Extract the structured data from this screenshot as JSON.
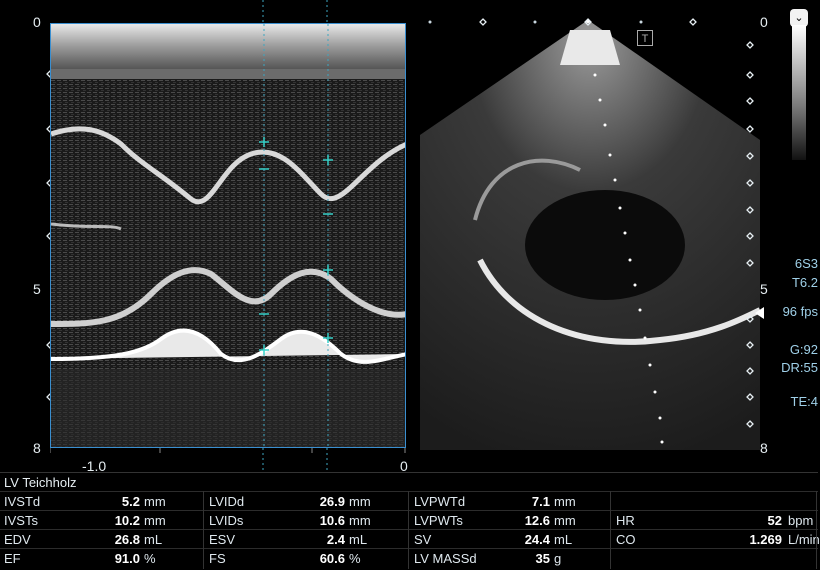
{
  "mmode": {
    "depth_ticks": [
      "0",
      "5",
      "8"
    ],
    "time_ticks": [
      "-1.0",
      "0"
    ]
  },
  "sector": {
    "depth_ticks": [
      "0",
      "5",
      "8"
    ],
    "t_button": "T"
  },
  "info": {
    "probe": "6S3",
    "freq": "T6.2",
    "fps": "96 fps",
    "gain": "G:92",
    "dr": "DR:55",
    "te": "TE:4"
  },
  "table": {
    "title": "LV Teichholz",
    "rows": [
      [
        {
          "label": "IVSTd",
          "value": "5.2",
          "unit": "mm"
        },
        {
          "label": "LVIDd",
          "value": "26.9",
          "unit": "mm"
        },
        {
          "label": "LVPWTd",
          "value": "7.1",
          "unit": "mm"
        },
        {
          "label": "",
          "value": "",
          "unit": ""
        }
      ],
      [
        {
          "label": "IVSTs",
          "value": "10.2",
          "unit": "mm"
        },
        {
          "label": "LVIDs",
          "value": "10.6",
          "unit": "mm"
        },
        {
          "label": "LVPWTs",
          "value": "12.6",
          "unit": "mm"
        },
        {
          "label": "HR",
          "value": "52",
          "unit": "bpm"
        }
      ],
      [
        {
          "label": "EDV",
          "value": "26.8",
          "unit": "mL"
        },
        {
          "label": "ESV",
          "value": "2.4",
          "unit": "mL"
        },
        {
          "label": "SV",
          "value": "24.4",
          "unit": "mL"
        },
        {
          "label": "CO",
          "value": "1.269",
          "unit": "L/min"
        }
      ],
      [
        {
          "label": "EF",
          "value": "91.0",
          "unit": "%"
        },
        {
          "label": "FS",
          "value": "60.6",
          "unit": "%"
        },
        {
          "label": "LV MASSd",
          "value": "35",
          "unit": "g"
        },
        {
          "label": "",
          "value": "",
          "unit": ""
        }
      ]
    ]
  }
}
